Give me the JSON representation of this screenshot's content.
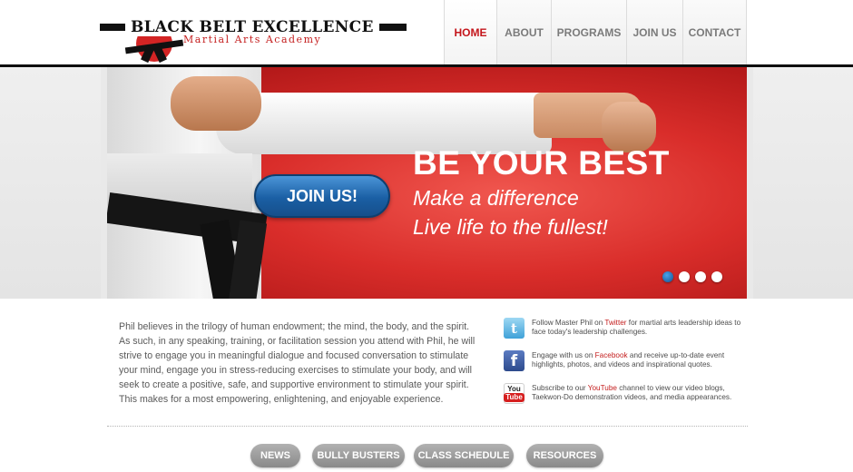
{
  "brand": {
    "name": "BLACK BELT EXCELLENCE",
    "subtitle": "Martial Arts Academy",
    "accent_color": "#c41e1e"
  },
  "nav": {
    "items": [
      {
        "label": "HOME",
        "active": true
      },
      {
        "label": "ABOUT",
        "active": false
      },
      {
        "label": "PROGRAMS",
        "active": false
      },
      {
        "label": "JOIN US",
        "active": false
      },
      {
        "label": "CONTACT",
        "active": false
      }
    ]
  },
  "hero": {
    "cta_label": "JOIN US!",
    "headline": "BE YOUR BEST",
    "tagline_1": "Make a difference",
    "tagline_2": "Live life to the fullest!",
    "slide_count": 4,
    "active_slide": 1
  },
  "intro": {
    "text": "Phil believes in the trilogy of human endowment; the mind, the body, and the spirit. As such, in any speaking, training, or facilitation session you attend with Phil, he will strive to engage you in meaningful dialogue and focused conversation to stimulate your mind, engage you in stress-reducing exercises to stimulate your body, and will seek to create a positive, safe, and supportive environment to stimulate your spirit. This makes for a most empowering, enlightening, and enjoyable experience."
  },
  "social": {
    "twitter": {
      "icon": "twitter-icon",
      "pre": "Follow Master Phil on ",
      "link": "Twitter",
      "post": " for martial arts leadership ideas to face today's leadership challenges."
    },
    "facebook": {
      "icon": "facebook-icon",
      "pre": "Engage with us on ",
      "link": "Facebook",
      "post": " and receive up-to-date event highlights, photos, and videos and inspirational quotes."
    },
    "youtube": {
      "icon": "youtube-icon",
      "pre": "Subscribe to our ",
      "link": "YouTube",
      "post": " channel to view our video blogs, Taekwon-Do demonstration videos, and media appearances.",
      "icon_text_top": "You",
      "icon_text_bottom": "Tube"
    }
  },
  "footer_buttons": [
    "NEWS",
    "BULLY BUSTERS",
    "CLASS SCHEDULE",
    "RESOURCES"
  ]
}
